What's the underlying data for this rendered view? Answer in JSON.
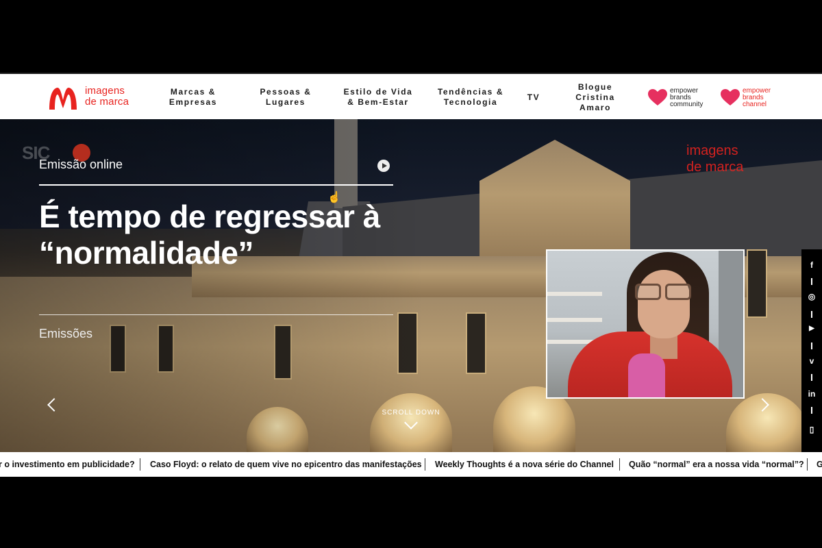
{
  "brand": {
    "logo_line1": "imagens",
    "logo_line2": "de marca",
    "accent_color": "#e8231f"
  },
  "nav": {
    "items": [
      {
        "label": "Marcas &\nEmpresas"
      },
      {
        "label": "Pessoas &\nLugares"
      },
      {
        "label": "Estilo de Vida\n& Bem-Estar"
      },
      {
        "label": "Tendências &\nTecnologia"
      },
      {
        "label": "TV"
      },
      {
        "label": "Blogue\nCristina\nAmaro"
      }
    ],
    "partners": [
      {
        "label": "empower\nbrands\ncommunity",
        "icon": "empower-heart-icon"
      },
      {
        "label": "empower\nbrands\nchannel",
        "icon": "empower-heart-icon"
      }
    ]
  },
  "hero": {
    "watermark_left": "SIC",
    "watermark_right_line1": "imagens",
    "watermark_right_line2": "de marca",
    "kicker": "Emissão online",
    "headline": "É tempo de regressar à “normalidade”",
    "category": "Emissões",
    "scroll_label": "SCROLL DOWN"
  },
  "social": {
    "icons": [
      "facebook-icon",
      "instagram-icon",
      "youtube-icon",
      "vimeo-icon",
      "linkedin-icon",
      "book-icon"
    ],
    "glyphs": [
      "f",
      "◎",
      "▶",
      "v",
      "in",
      "▯"
    ]
  },
  "ticker": {
    "items": [
      "r o investimento em publicidade?",
      "Caso Floyd: o relato de quem vive no epicentro das manifestações",
      "Weekly Thoughts é a nova série do Channel",
      "Quão “normal” era a nossa vida “normal”?",
      "G"
    ]
  }
}
